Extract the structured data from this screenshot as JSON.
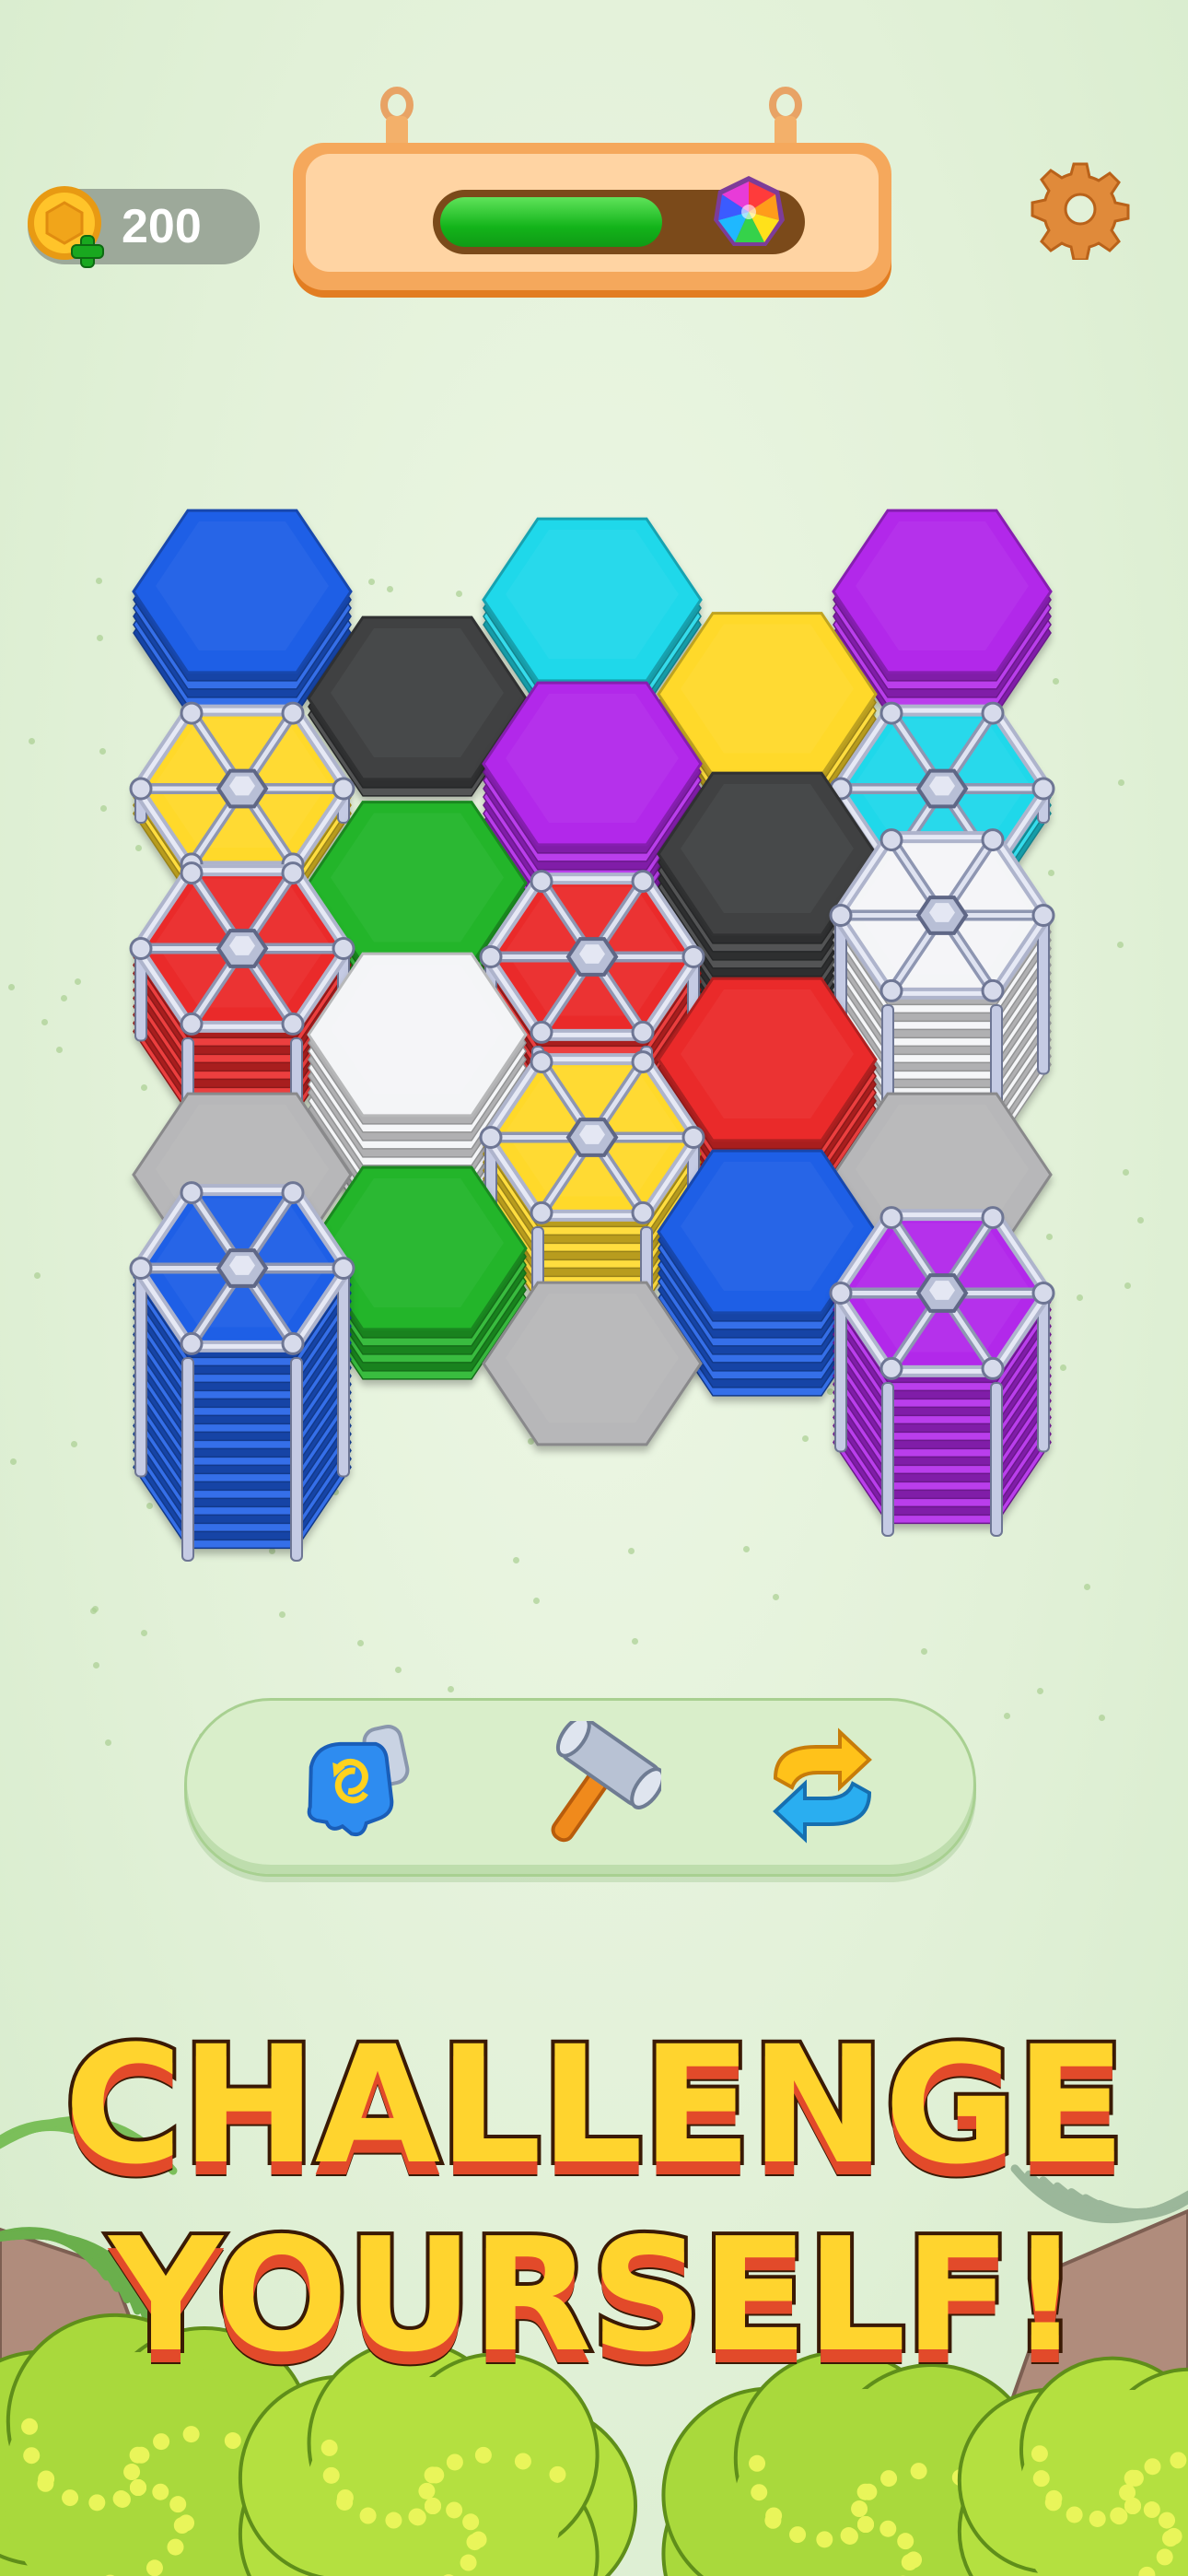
{
  "coins": {
    "count": "200",
    "icon": "coin-icon",
    "add_icon": "plus-icon"
  },
  "level_progress": {
    "fraction": 0.62,
    "prize_icon": "rainbow-ball-icon"
  },
  "settings": {
    "icon": "gear-icon"
  },
  "colors": {
    "blue": "#1e5fe6",
    "cyan": "#1fd8ea",
    "magenta": "#b228ea",
    "yellow": "#ffd92a",
    "black": "#404142",
    "green": "#23b52a",
    "white": "#f4f5f7",
    "red": "#ea2a2a",
    "gray": "#b7b7b9"
  },
  "board": {
    "tiles": [
      {
        "id": "t1",
        "col": 0,
        "row": 0,
        "color": "blue",
        "layers": 5,
        "locked": false
      },
      {
        "id": "t2",
        "col": 2,
        "row": 0,
        "color": "cyan",
        "layers": 3,
        "locked": false
      },
      {
        "id": "t3",
        "col": 4,
        "row": 0,
        "color": "magenta",
        "layers": 5,
        "locked": false
      },
      {
        "id": "t4",
        "col": 1,
        "row": 1,
        "color": "black",
        "layers": 2,
        "locked": false
      },
      {
        "id": "t5",
        "col": 3,
        "row": 1,
        "color": "yellow",
        "layers": 3,
        "locked": false
      },
      {
        "id": "t6",
        "col": 2,
        "row": 2,
        "color": "magenta",
        "layers": 9,
        "locked": false
      },
      {
        "id": "t7",
        "col": 0,
        "row": 2,
        "color": "yellow",
        "layers": 3,
        "locked": true
      },
      {
        "id": "t8",
        "col": 4,
        "row": 2,
        "color": "cyan",
        "layers": 3,
        "locked": true
      },
      {
        "id": "t9",
        "col": 1,
        "row": 3,
        "color": "green",
        "layers": 3,
        "locked": false
      },
      {
        "id": "t10",
        "col": 3,
        "row": 3,
        "color": "black",
        "layers": 10,
        "locked": false
      },
      {
        "id": "t11",
        "col": 4,
        "row": 4,
        "color": "white",
        "layers": 18,
        "locked": true
      },
      {
        "id": "t12",
        "col": 0,
        "row": 4,
        "color": "red",
        "layers": 10,
        "locked": true
      },
      {
        "id": "t13",
        "col": 2,
        "row": 4,
        "color": "red",
        "layers": 8,
        "locked": true
      },
      {
        "id": "t14",
        "col": 1,
        "row": 5,
        "color": "white",
        "layers": 12,
        "locked": false
      },
      {
        "id": "t15",
        "col": 3,
        "row": 5,
        "color": "red",
        "layers": 6,
        "locked": false
      },
      {
        "id": "t16",
        "col": 0,
        "row": 6,
        "color": "gray",
        "layers": 0,
        "locked": false
      },
      {
        "id": "t17",
        "col": 2,
        "row": 6,
        "color": "yellow",
        "layers": 10,
        "locked": true
      },
      {
        "id": "t18",
        "col": 4,
        "row": 6,
        "color": "gray",
        "layers": 0,
        "locked": false
      },
      {
        "id": "t19",
        "col": 1,
        "row": 7,
        "color": "green",
        "layers": 6,
        "locked": false
      },
      {
        "id": "t20",
        "col": 3,
        "row": 7,
        "color": "blue",
        "layers": 10,
        "locked": false
      },
      {
        "id": "t21",
        "col": 0,
        "row": 8,
        "color": "blue",
        "layers": 24,
        "locked": true
      },
      {
        "id": "t22",
        "col": 2,
        "row": 8,
        "color": "gray",
        "layers": 0,
        "locked": false
      },
      {
        "id": "t23",
        "col": 4,
        "row": 8,
        "color": "magenta",
        "layers": 18,
        "locked": true
      }
    ]
  },
  "boosters": [
    {
      "name": "glove",
      "icon": "glove-swap-icon"
    },
    {
      "name": "hammer",
      "icon": "hammer-icon"
    },
    {
      "name": "shuffle",
      "icon": "shuffle-arrows-icon"
    }
  ],
  "headline": {
    "line1": "CHALLENGE",
    "line2": "YOURSELF!"
  }
}
